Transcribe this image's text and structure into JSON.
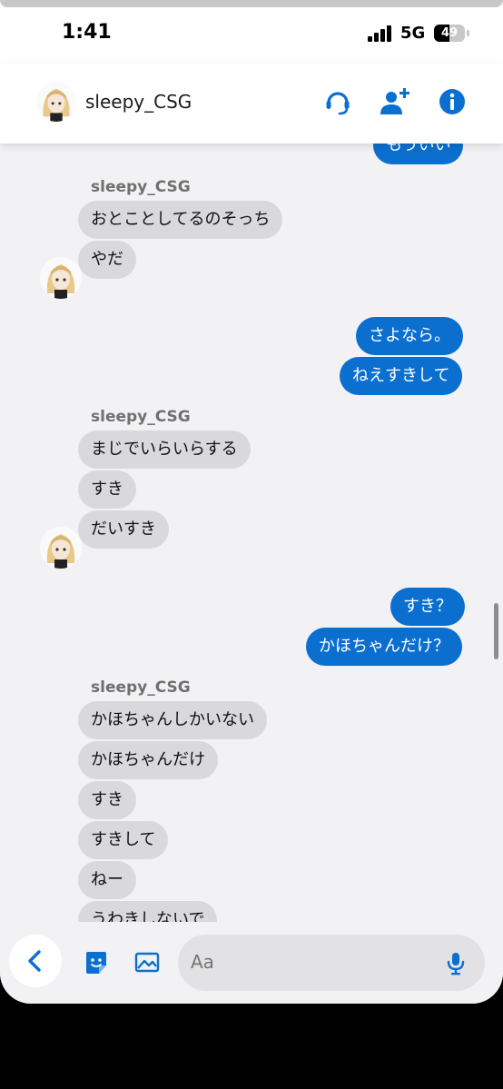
{
  "status_bar": {
    "time": "1:41",
    "network": "5G",
    "battery": "49",
    "battery_level": 0.49
  },
  "header": {
    "contact_name": "sleepy_CSG",
    "icons": [
      "headset-icon",
      "add-person-icon",
      "info-icon"
    ]
  },
  "colors": {
    "accent": "#0b6fd0",
    "incoming_bubble": "#d9d9db",
    "background": "#f2f2f4"
  },
  "messages": {
    "m0": "もういい",
    "sender1": "sleepy_CSG",
    "m1": "おとことしてるのそっち",
    "m2": "やだ",
    "m3": "さよなら。",
    "m4": "ねえすきして",
    "sender2": "sleepy_CSG",
    "m5": "まじでいらいらする",
    "m6": "すき",
    "m7": "だいすき",
    "m8": "すき？",
    "m9": "かほちゃんだけ？",
    "sender3": "sleepy_CSG",
    "m10": "かほちゃんしかいない",
    "m11": "かほちゃんだけ",
    "m12": "すき",
    "m13": "すきして",
    "m14": "ねー",
    "m15": "うわきしないで"
  },
  "composer": {
    "placeholder": "Aa",
    "icons": [
      "back-chevron-icon",
      "sticker-icon",
      "image-icon",
      "mic-icon"
    ]
  }
}
